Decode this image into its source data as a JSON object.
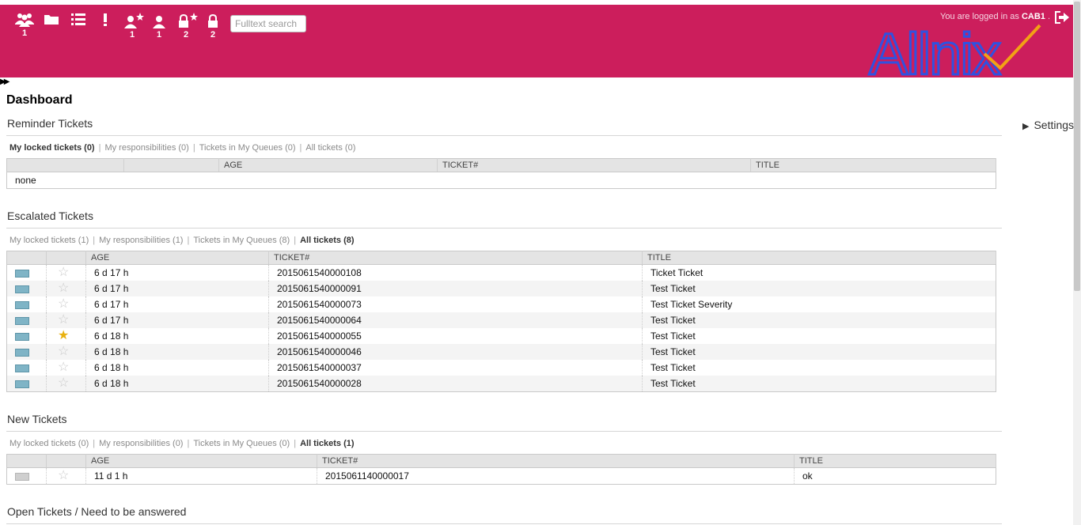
{
  "header": {
    "nav": [
      {
        "name": "customers-icon",
        "count": "1"
      },
      {
        "name": "folder-icon",
        "count": ""
      },
      {
        "name": "list-icon",
        "count": ""
      },
      {
        "name": "escalation-icon",
        "count": ""
      },
      {
        "name": "responsible-icon",
        "count": "1"
      },
      {
        "name": "watched-user-icon",
        "count": "1"
      },
      {
        "name": "locked-new-icon",
        "count": "2"
      },
      {
        "name": "lock-icon",
        "count": "2"
      }
    ],
    "search_placeholder": "Fulltext search",
    "login_prefix": "You are logged in as",
    "login_user": "CAB1",
    "login_suffix": ".",
    "logo_text": "Allnix",
    "colors": {
      "header_bg": "#cc1e5c",
      "logo_blue": "#2f52e0",
      "logo_orange": "#f2a115"
    }
  },
  "page_title": "Dashboard",
  "settings_label": "Settings",
  "reminder": {
    "title": "Reminder Tickets",
    "filters": [
      {
        "label": "My locked tickets (0)",
        "active": true
      },
      {
        "label": "My responsibilities (0)",
        "active": false
      },
      {
        "label": "Tickets in My Queues (0)",
        "active": false
      },
      {
        "label": "All tickets (0)",
        "active": false
      }
    ],
    "columns": [
      "AGE",
      "TICKET#",
      "TITLE"
    ],
    "empty": "none"
  },
  "escalated": {
    "title": "Escalated Tickets",
    "filters": [
      {
        "label": "My locked tickets (1)",
        "active": false
      },
      {
        "label": "My responsibilities (1)",
        "active": false
      },
      {
        "label": "Tickets in My Queues (8)",
        "active": false
      },
      {
        "label": "All tickets (8)",
        "active": true
      }
    ],
    "columns": [
      "AGE",
      "TICKET#",
      "TITLE"
    ],
    "rows": [
      {
        "age": "6 d 17 h",
        "ticket": "2015061540000108",
        "title": "Ticket Ticket",
        "fav": false
      },
      {
        "age": "6 d 17 h",
        "ticket": "2015061540000091",
        "title": "Test Ticket",
        "fav": false
      },
      {
        "age": "6 d 17 h",
        "ticket": "2015061540000073",
        "title": "Test Ticket Severity",
        "fav": false
      },
      {
        "age": "6 d 17 h",
        "ticket": "2015061540000064",
        "title": "Test Ticket",
        "fav": false
      },
      {
        "age": "6 d 18 h",
        "ticket": "2015061540000055",
        "title": "Test Ticket",
        "fav": true
      },
      {
        "age": "6 d 18 h",
        "ticket": "2015061540000046",
        "title": "Test Ticket",
        "fav": false
      },
      {
        "age": "6 d 18 h",
        "ticket": "2015061540000037",
        "title": "Test Ticket",
        "fav": false
      },
      {
        "age": "6 d 18 h",
        "ticket": "2015061540000028",
        "title": "Test Ticket",
        "fav": false
      }
    ]
  },
  "new": {
    "title": "New Tickets",
    "filters": [
      {
        "label": "My locked tickets (0)",
        "active": false
      },
      {
        "label": "My responsibilities (0)",
        "active": false
      },
      {
        "label": "Tickets in My Queues (0)",
        "active": false
      },
      {
        "label": "All tickets (1)",
        "active": true
      }
    ],
    "columns": [
      "AGE",
      "TICKET#",
      "TITLE"
    ],
    "rows": [
      {
        "age": "11 d 1 h",
        "ticket": "2015061140000017",
        "title": "ok",
        "fav": false
      }
    ]
  },
  "open": {
    "title": "Open Tickets / Need to be answered"
  }
}
